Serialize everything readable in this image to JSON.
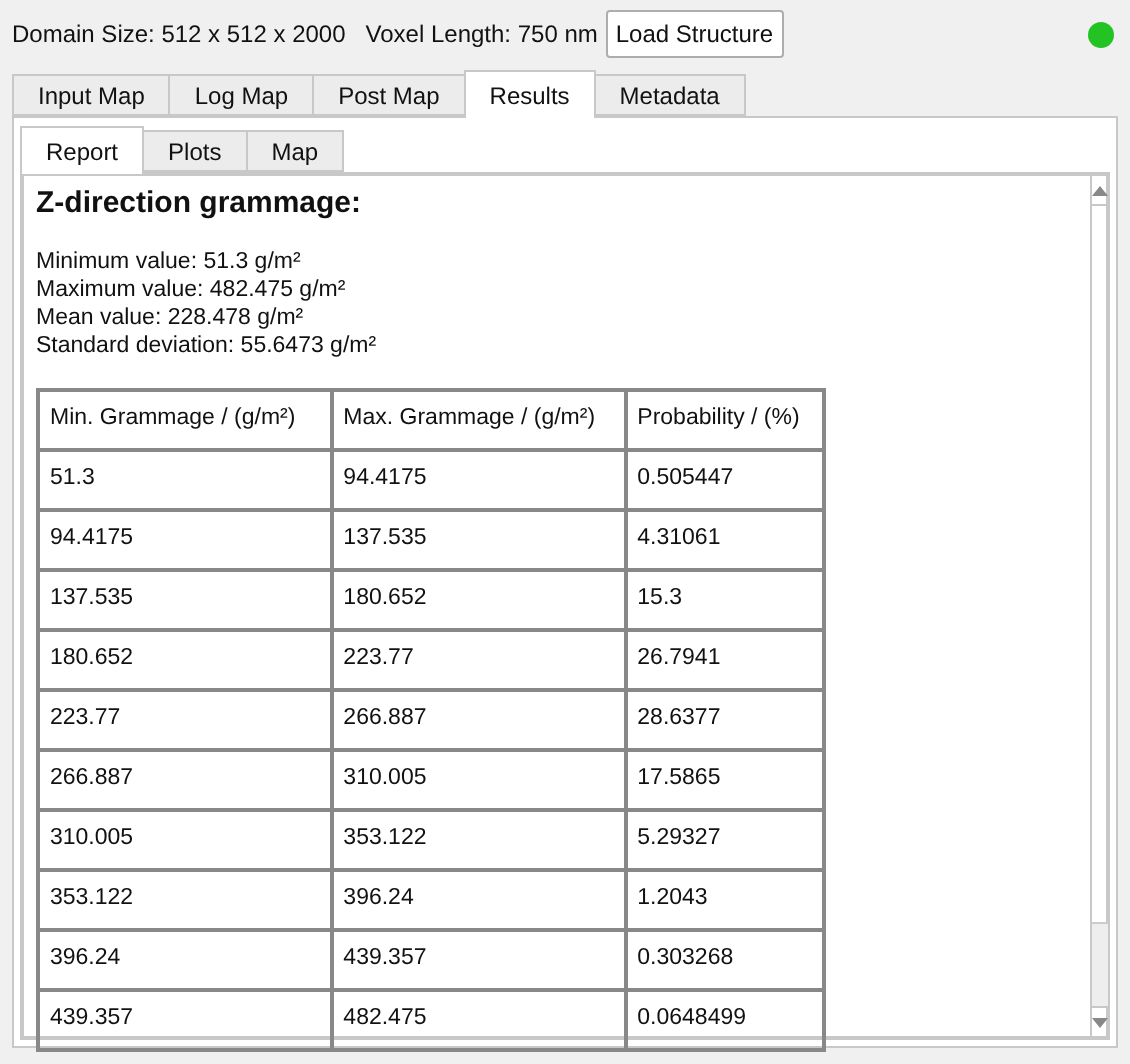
{
  "toolbar": {
    "domain_size": "Domain Size: 512 x 512 x 2000",
    "voxel_length": "Voxel Length: 750 nm",
    "load_button": "Load Structure",
    "status_indicator": {
      "on": true
    }
  },
  "tabs": [
    {
      "label": "Input Map",
      "selected": false
    },
    {
      "label": "Log Map",
      "selected": false
    },
    {
      "label": "Post Map",
      "selected": false
    },
    {
      "label": "Results",
      "selected": true
    },
    {
      "label": "Metadata",
      "selected": false
    }
  ],
  "subtabs": [
    {
      "label": "Report",
      "selected": true
    },
    {
      "label": "Plots",
      "selected": false
    },
    {
      "label": "Map",
      "selected": false
    }
  ],
  "report": {
    "heading": "Z-direction grammage:",
    "stats": [
      "Minimum value: 51.3 g/m²",
      "Maximum value: 482.475 g/m²",
      "Mean value: 228.478 g/m²",
      "Standard deviation: 55.6473 g/m²"
    ],
    "table": {
      "columns": [
        "Min. Grammage / (g/m²)",
        "Max. Grammage / (g/m²)",
        "Probability / (%)"
      ],
      "rows": [
        [
          "51.3",
          "94.4175",
          "0.505447"
        ],
        [
          "94.4175",
          "137.535",
          "4.31061"
        ],
        [
          "137.535",
          "180.652",
          "15.3"
        ],
        [
          "180.652",
          "223.77",
          "26.7941"
        ],
        [
          "223.77",
          "266.887",
          "28.6377"
        ],
        [
          "266.887",
          "310.005",
          "17.5865"
        ],
        [
          "310.005",
          "353.122",
          "5.29327"
        ],
        [
          "353.122",
          "396.24",
          "1.2043"
        ],
        [
          "396.24",
          "439.357",
          "0.303268"
        ],
        [
          "439.357",
          "482.475",
          "0.0648499"
        ]
      ]
    }
  }
}
